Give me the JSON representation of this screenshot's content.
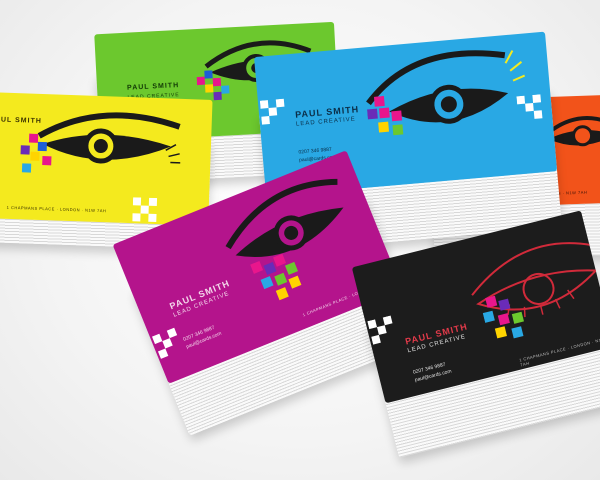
{
  "colors": {
    "yellow": "#f4ea1e",
    "green": "#6cc82e",
    "blue": "#29a8e4",
    "orange": "#f2531a",
    "magenta": "#b4148c",
    "black": "#1c1c1c"
  },
  "card": {
    "name": "PAUL SMITH",
    "role": "LEAD CREATIVE",
    "phone": "0207 346 9887",
    "email": "paul@cards.com",
    "address": "1 CHAPMANS PLACE · LONDON · N1W 7AH"
  },
  "icons": {
    "eye": "eye-illustration",
    "pixels": "color-pixel-squares",
    "corner": "checker-corner"
  }
}
